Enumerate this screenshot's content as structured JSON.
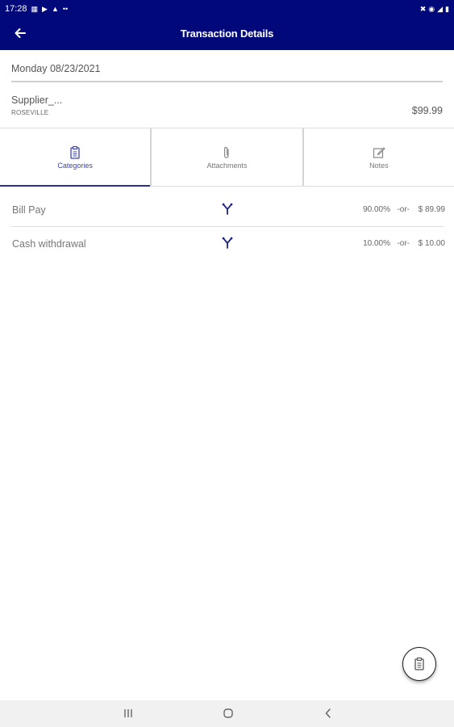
{
  "status_bar": {
    "time": "17:28",
    "icons_left": [
      "notification-icon",
      "media-icon",
      "alert-icon",
      "more-dots-icon"
    ],
    "icons_right": [
      "bluetooth-icon",
      "wifi-icon",
      "signal-icon",
      "battery-icon"
    ]
  },
  "header": {
    "title": "Transaction Details",
    "background": "#00087a",
    "back_icon": "arrow-left-icon"
  },
  "transaction": {
    "date": "Monday 08/23/2021",
    "merchant_name": "Supplier_...",
    "merchant_city": "ROSEVILLE",
    "amount": "$99.99"
  },
  "tabs": [
    {
      "label": "Categories",
      "icon": "clipboard-icon",
      "active": true
    },
    {
      "label": "Attachments",
      "icon": "paperclip-icon",
      "active": false
    },
    {
      "label": "Notes",
      "icon": "edit-icon",
      "active": false
    }
  ],
  "categories": [
    {
      "name": "Bill Pay",
      "percent": "90.00%",
      "or": "-or-",
      "amount": "$ 89.99",
      "icon": "split-icon"
    },
    {
      "name": "Cash withdrawal",
      "percent": "10.00%",
      "or": "-or-",
      "amount": "$ 10.00",
      "icon": "split-icon"
    }
  ],
  "fab": {
    "icon": "clipboard-icon"
  },
  "nav_bar": {
    "buttons": [
      "recents-icon",
      "home-icon",
      "back-chevron-icon"
    ]
  },
  "colors": {
    "primary": "#00087a",
    "accent": "#3b43b5"
  }
}
